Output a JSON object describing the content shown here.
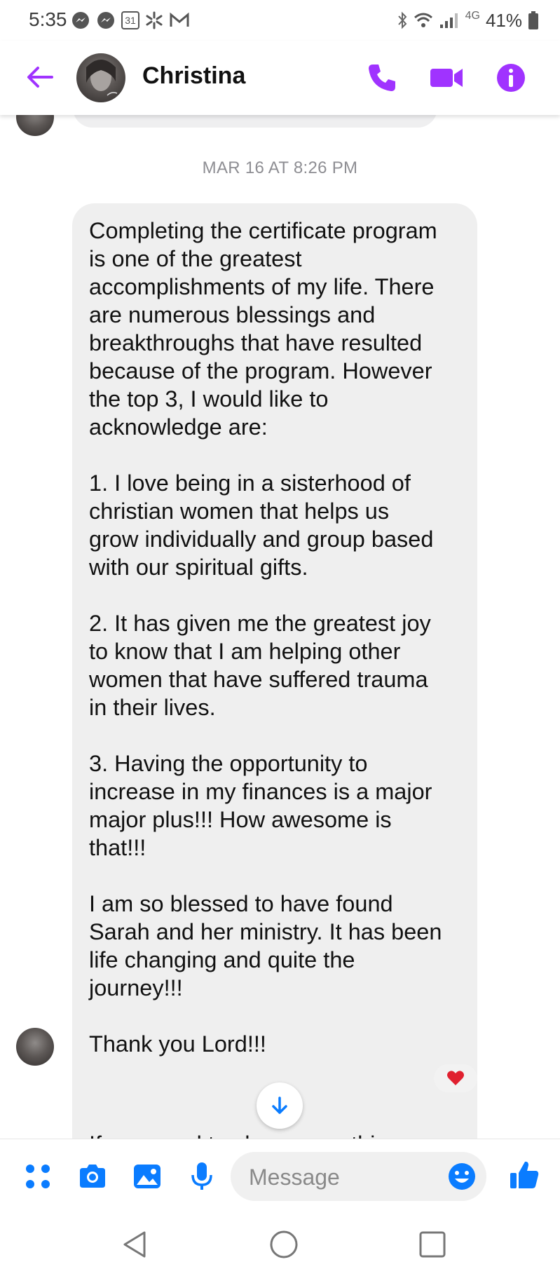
{
  "status_bar": {
    "time": "5:35",
    "calendar_day": "31",
    "network": "4G",
    "battery": "41%"
  },
  "header": {
    "contact_name": "Christina"
  },
  "chat": {
    "timestamp": "MAR 16 AT 8:26 PM",
    "message_paragraphs": [
      "Completing the certificate program\nis one of the greatest\naccomplishments of my life. There\nare numerous blessings and\nbreakthroughs that have resulted\nbecause of the program. However\nthe top 3, I would like to\nacknowledge are:",
      "1. I love being in a sisterhood of\nchristian women that helps us\ngrow individually and group based\nwith our spiritual gifts.",
      "2. It has given me the greatest joy\nto know that I am helping other\nwomen that have suffered trauma\nin their lives.",
      "3. Having the opportunity to\nincrease in my finances is a major\nmajor plus!!! How awesome is\nthat!!!",
      "I am so blessed to have found\nSarah and her ministry. It has been\nlife changing and quite the\njourney!!!",
      "Thank you Lord!!!"
    ],
    "reaction": "heart",
    "next_message_partial": "If you need to change anything"
  },
  "composer": {
    "placeholder": "Message"
  },
  "colors": {
    "accent": "#a033ff",
    "composer_blue": "#0a7cff",
    "bubble_gray": "#efefef",
    "reaction_red": "#e0202f"
  },
  "icons": {
    "header": [
      "back-arrow-icon",
      "phone-icon",
      "video-icon",
      "info-icon"
    ],
    "composer": [
      "apps-icon",
      "camera-icon",
      "gallery-icon",
      "microphone-icon",
      "emoji-icon",
      "thumbs-up-icon"
    ],
    "navbar": [
      "back-triangle-icon",
      "home-circle-icon",
      "recents-square-icon"
    ]
  }
}
